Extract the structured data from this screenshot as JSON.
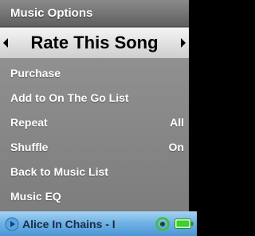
{
  "header": {
    "title": "Music Options"
  },
  "selected": {
    "label": "Rate This Song"
  },
  "menu": {
    "items": [
      {
        "label": "Purchase",
        "value": ""
      },
      {
        "label": "Add to On The Go List",
        "value": ""
      },
      {
        "label": "Repeat",
        "value": "All"
      },
      {
        "label": "Shuffle",
        "value": "On"
      },
      {
        "label": "Back to Music List",
        "value": ""
      },
      {
        "label": "Music EQ",
        "value": ""
      }
    ]
  },
  "now_playing": {
    "text": "Alice In Chains - I"
  },
  "icons": {
    "left": "arrow-left-icon",
    "right": "arrow-right-icon",
    "play": "play-icon",
    "shuffle": "shuffle-on-icon",
    "battery": "battery-icon"
  },
  "colors": {
    "header_bg": "#737373",
    "menu_bg": "#8e8e8e",
    "selected_bg": "#e2e2e2",
    "now_playing_bg": "#72b3e6",
    "battery_green": "#3ad12b",
    "shuffle_green": "#4ad23a"
  }
}
